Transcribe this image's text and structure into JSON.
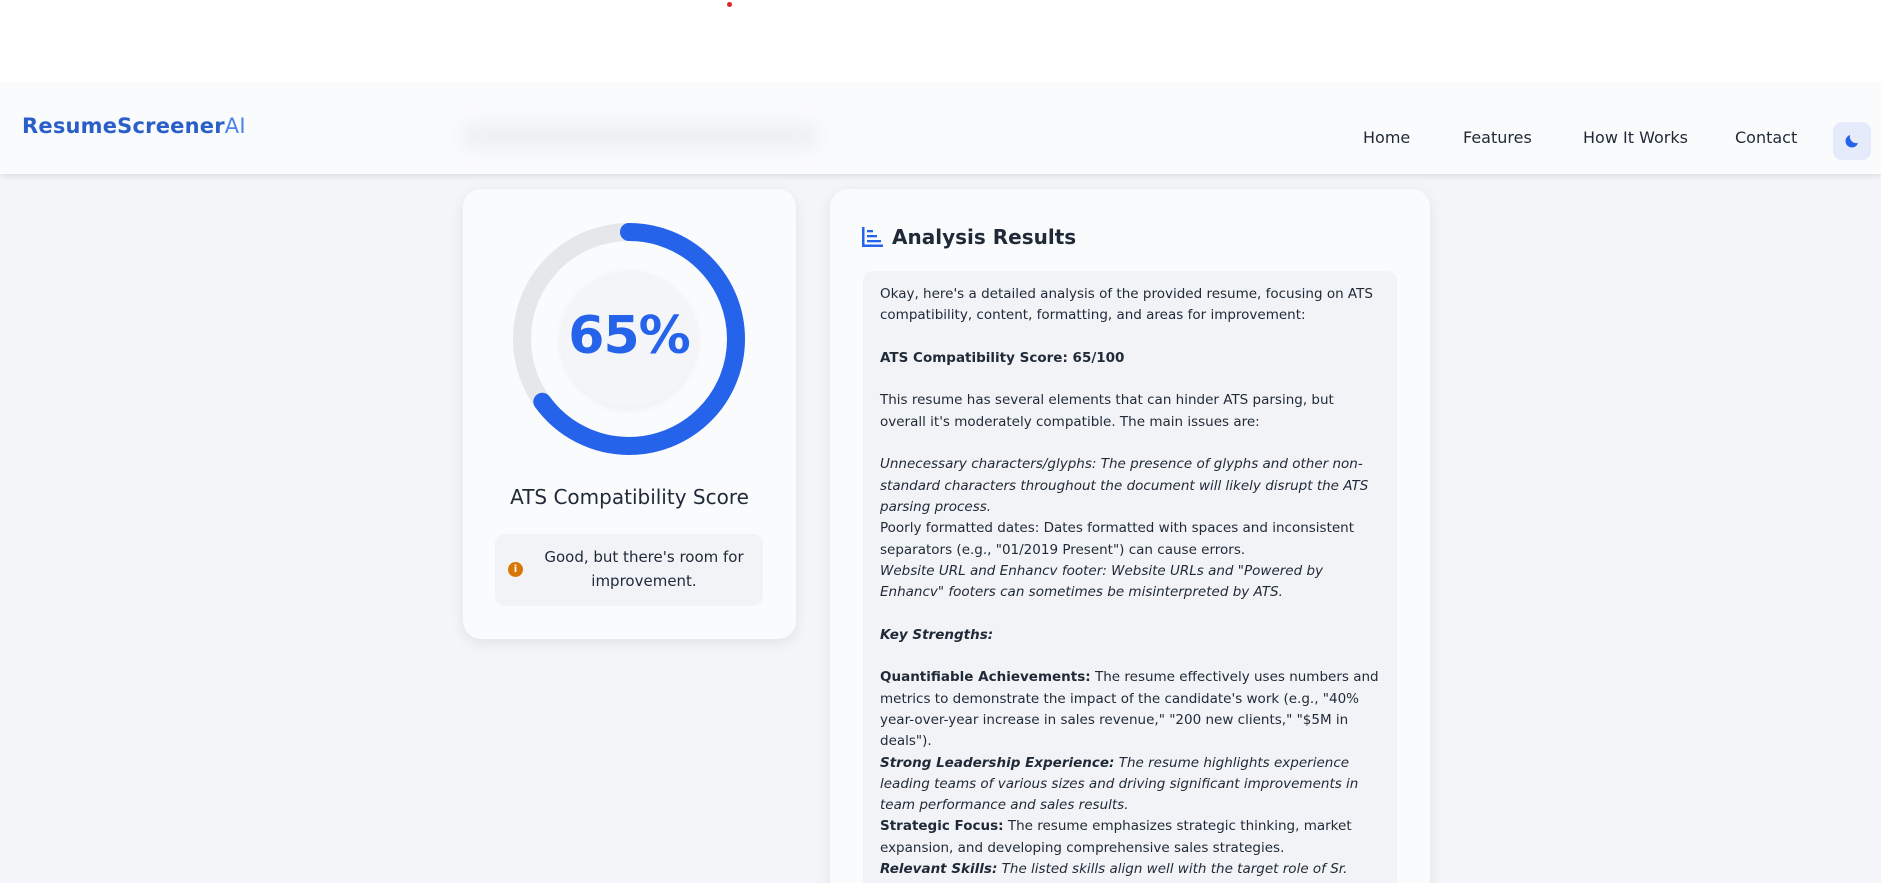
{
  "brand": {
    "name_part1": "ResumeScreener",
    "name_part2": "AI"
  },
  "nav": {
    "home": "Home",
    "features": "Features",
    "how_it_works": "How It Works",
    "contact": "Contact"
  },
  "theme_toggle": {
    "icon": "moon-icon"
  },
  "score_card": {
    "score_percent": 65,
    "score_label": "65%",
    "title": "ATS Compatibility Score",
    "note": "Good, but there's room for improvement.",
    "note_icon": "info-icon"
  },
  "analysis": {
    "title": "Analysis Results",
    "intro": "Okay, here's a detailed analysis of the provided resume, focusing on ATS compatibility, content, formatting, and areas for improvement:",
    "score_heading": "ATS Compatibility Score: 65/100",
    "summary": "This resume has several elements that can hinder ATS parsing, but overall it's moderately compatible. The main issues are:",
    "issues": [
      "Unnecessary characters/glyphs: The presence of glyphs and other non-standard characters throughout the document will likely disrupt the ATS parsing process.",
      "Poorly formatted dates: Dates formatted with spaces and inconsistent separators (e.g., \"01/2019 Present\") can cause errors.",
      "Website URL and Enhancv footer: Website URLs and \"Powered by Enhancv\" footers can sometimes be misinterpreted by ATS."
    ],
    "strengths_heading": "Key Strengths:",
    "strengths": [
      {
        "label": "Quantifiable Achievements:",
        "text": " The resume effectively uses numbers and metrics to demonstrate the impact of the candidate's work (e.g., \"40% year-over-year increase in sales revenue,\" \"200 new clients,\" \"$5M in deals\")."
      },
      {
        "label": "Strong Leadership Experience:",
        "text": " The resume highlights experience leading teams of various sizes and driving significant improvements in team performance and sales results."
      },
      {
        "label": "Strategic Focus:",
        "text": " The resume emphasizes strategic thinking, market expansion, and developing comprehensive sales strategies."
      },
      {
        "label": "Relevant Skills:",
        "text": " The listed skills align well with the target role of Sr. Sales Manager/Director."
      }
    ]
  },
  "colors": {
    "accent": "#2563eb",
    "gauge_track": "#e5e7eb",
    "warning": "#d97706"
  }
}
